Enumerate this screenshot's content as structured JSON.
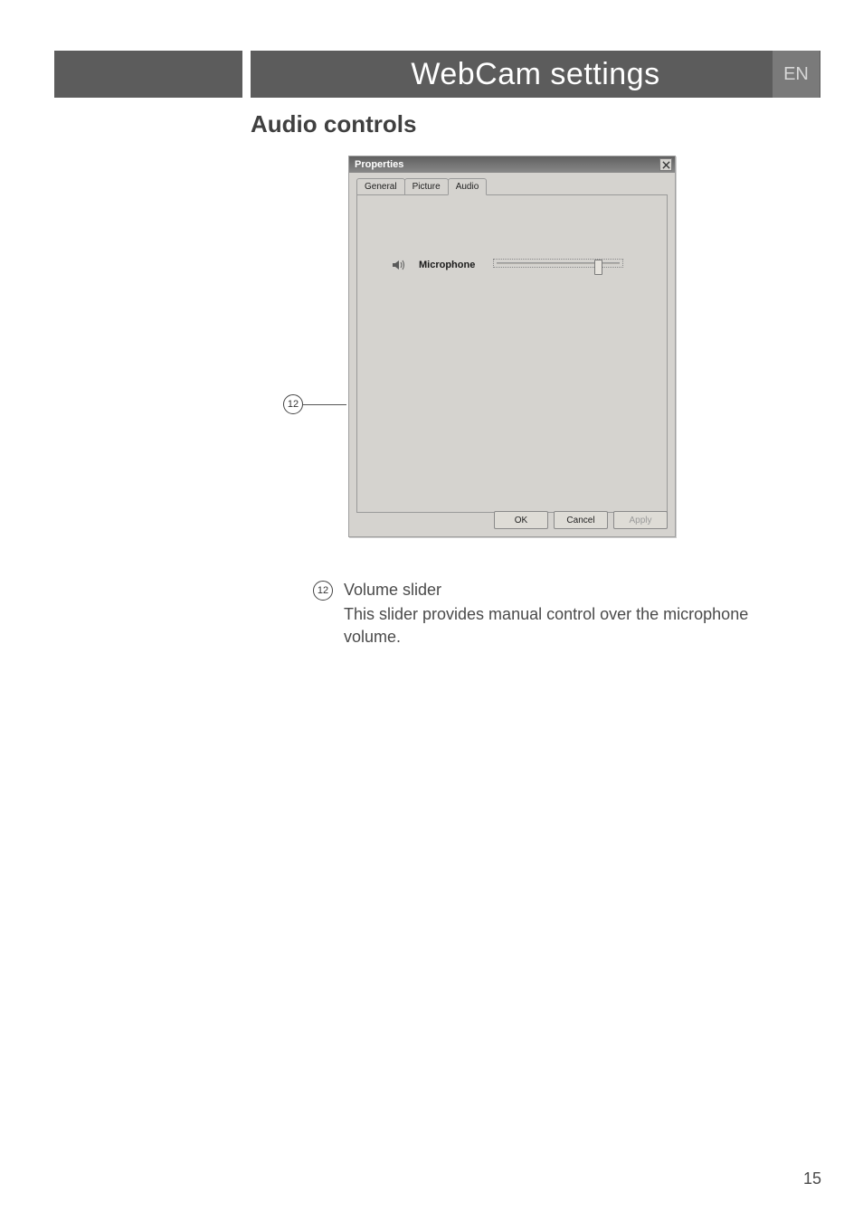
{
  "header": {
    "title": "WebCam settings",
    "lang": "EN"
  },
  "section": {
    "title": "Audio controls"
  },
  "callout": "12",
  "dialog": {
    "title": "Properties",
    "tabs": [
      "General",
      "Picture",
      "Audio"
    ],
    "active_tab_index": 2,
    "microphone": {
      "label": "Microphone",
      "slider_value_percent": 80
    },
    "buttons": {
      "ok": "OK",
      "cancel": "Cancel",
      "apply": "Apply"
    }
  },
  "description": {
    "num": "12",
    "term": "Volume slider",
    "text": "This slider provides manual control over the microphone volume."
  },
  "page_number": "15"
}
